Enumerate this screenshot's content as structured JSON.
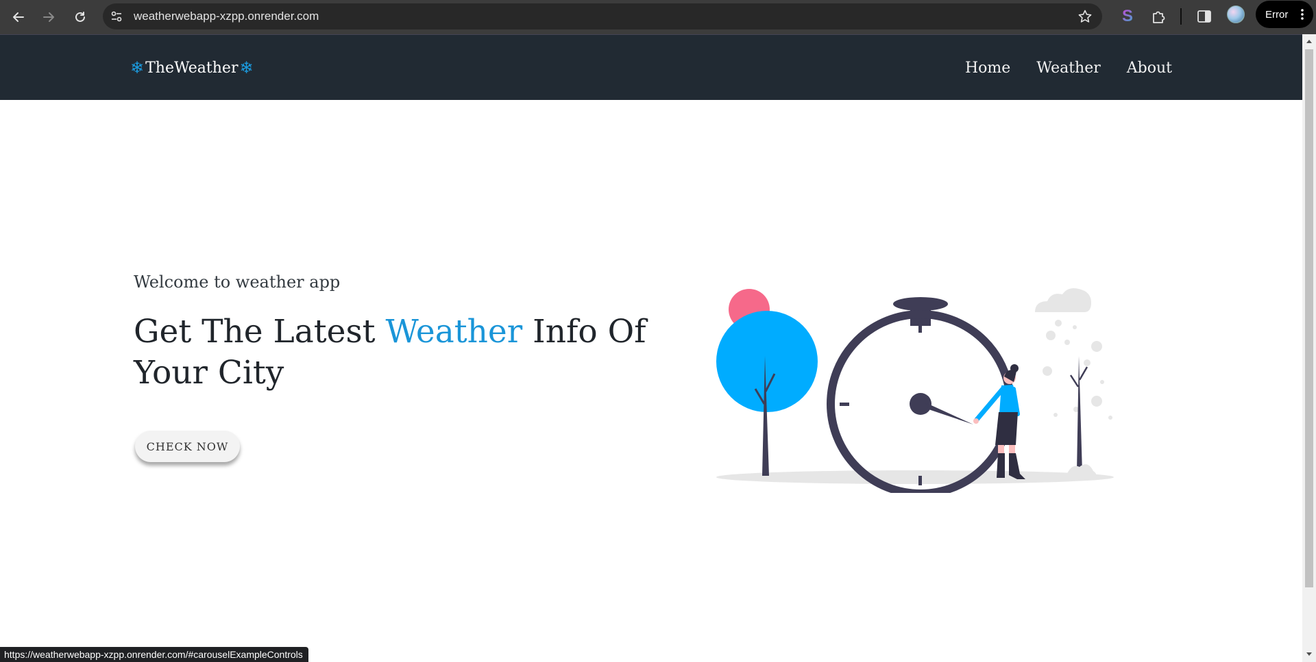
{
  "browser": {
    "url": "weatherwebapp-xzpp.onrender.com",
    "profile_status": "Error",
    "status_url": "https://weatherwebapp-xzpp.onrender.com/#carouselExampleControls"
  },
  "site": {
    "brand": "TheWeather",
    "nav": [
      "Home",
      "Weather",
      "About"
    ]
  },
  "hero": {
    "welcome": "Welcome to weather app",
    "title_before": "Get The Latest ",
    "title_accent": "Weather",
    "title_after": " Info Of Your City",
    "cta": "CHECK NOW"
  },
  "colors": {
    "nav_bg": "#212a33",
    "accent": "#1a95d8",
    "tree_blue": "#00acff",
    "sun_pink": "#f6698a",
    "clock_dark": "#3f3d56"
  }
}
